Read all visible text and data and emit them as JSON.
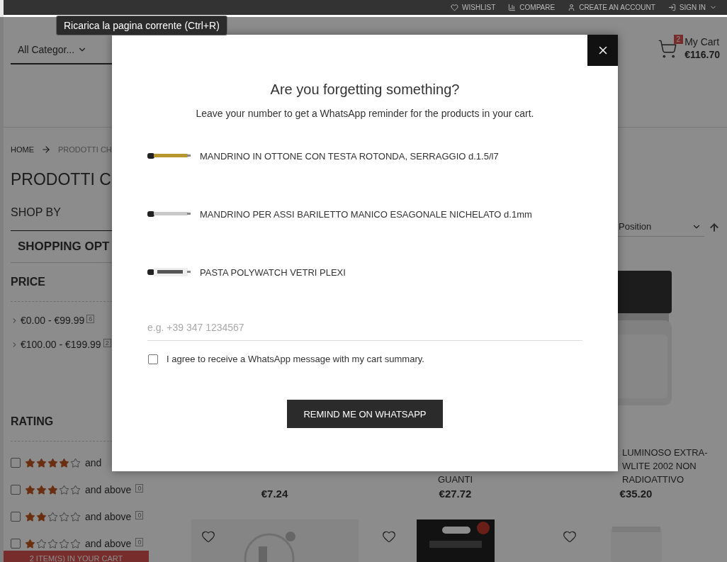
{
  "top_links": [
    {
      "kind": "wishlist",
      "label": "WISHLIST"
    },
    {
      "kind": "compare",
      "label": "COMPARE"
    },
    {
      "kind": "account",
      "label": "CREATE AN ACCOUNT"
    },
    {
      "kind": "signin",
      "label": "SIGN IN"
    }
  ],
  "tooltip": "Ricarica la pagina corrente (Ctrl+R)",
  "header": {
    "category": "All Categor...",
    "cart": {
      "count": "2",
      "label": "My Cart",
      "total": "€116.70"
    }
  },
  "breadcrumb": [
    "HOME",
    "PRODOTTI CH"
  ],
  "page_title": "PRODOTTI C",
  "sidebar": {
    "shop_by": "SHOP BY",
    "options_title": "SHOPPING OPT",
    "price": {
      "title": "PRICE",
      "ranges": [
        {
          "label": "€0.00 - €99.99",
          "count": "6"
        },
        {
          "label": "€100.00 - €199.99",
          "count": "2"
        }
      ]
    },
    "rating": {
      "title": "RATING",
      "rows": [
        {
          "stars": 4,
          "label": "and",
          "checked": false
        },
        {
          "stars": 3,
          "label": "and above",
          "count": "0",
          "checked": false
        },
        {
          "stars": 2,
          "label": "and above",
          "count": "0",
          "checked": false
        },
        {
          "stars": 1,
          "label": "and above",
          "count": "0",
          "checked": false
        }
      ]
    }
  },
  "sorter": {
    "value": "Position"
  },
  "products": [
    {
      "price": "€7.24"
    },
    {
      "name": [
        "GUANTI"
      ],
      "price": "€27.72"
    },
    {
      "picture": true,
      "name": [
        "LUMINOSO EXTRA-",
        "WLITE 2002 NON",
        "RADIOATTIVO"
      ],
      "price": "€35.20"
    }
  ],
  "more_products": [
    {
      "kind": "picture"
    },
    {
      "kind": "package"
    },
    {
      "kind": "bottle"
    }
  ],
  "cart_bar": "2 ITEM(S) IN YOUR CART",
  "modal": {
    "title": "Are you forgetting something?",
    "subtitle": "Leave your number to get a WhatsApp reminder for the products in your cart.",
    "items": [
      {
        "kind": "brass",
        "name": "MANDRINO IN OTTONE CON TESTA ROTONDA, SERRAGGIO d.1.5/l7"
      },
      {
        "kind": "steel",
        "name": "MANDRINO PER ASSI BARILETTO MANICO ESAGONALE NICHELATO d.1mm"
      },
      {
        "kind": "tube",
        "name": "PASTA POLYWATCH VETRI PLEXI"
      }
    ],
    "phone": {
      "placeholder": "e.g. +39 347 1234567"
    },
    "consent": {
      "label": "I agree to receive a WhatsApp message with my cart summary.",
      "checked": false
    },
    "button": "REMIND ME ON WHATSAPP"
  }
}
